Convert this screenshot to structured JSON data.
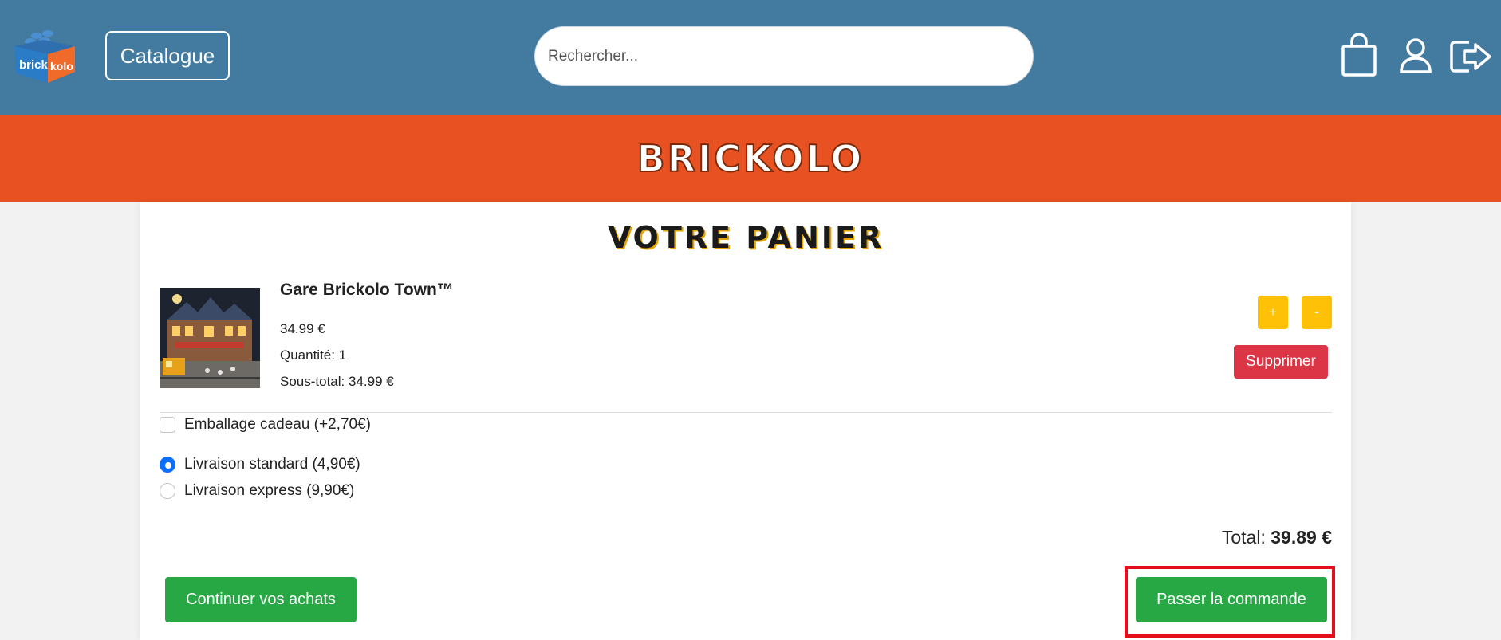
{
  "header": {
    "logo_text_left": "brick",
    "logo_text_right": "kolo",
    "catalogue_label": "Catalogue",
    "search_placeholder": "Rechercher...",
    "icons": [
      "shopping-bag-icon",
      "user-icon",
      "logout-icon"
    ]
  },
  "banner": {
    "title": "BRICKOLO"
  },
  "cart": {
    "title": "VOTRE PANIER",
    "item": {
      "name": "Gare Brickolo Town™",
      "price": "34.99 €",
      "quantity": "Quantité: 1",
      "subtotal": "Sous-total: 34.99 €",
      "plus_label": "+",
      "minus_label": "-",
      "delete_label": "Supprimer"
    },
    "gift_wrap_label": "Emballage cadeau (+2,70€)",
    "shipping": [
      {
        "label": "Livraison standard (4,90€)",
        "selected": true
      },
      {
        "label": "Livraison express (9,90€)",
        "selected": false
      }
    ],
    "total_label": "Total:",
    "total_value": "39.89 €",
    "continue_label": "Continuer vos achats",
    "checkout_label": "Passer la commande"
  },
  "colors": {
    "header_bg": "#437aa0",
    "banner_bg": "#e85222",
    "warning": "#ffc107",
    "danger": "#dc3545",
    "success": "#28a745",
    "primary": "#0d6efd",
    "highlight": "#e3101c"
  }
}
